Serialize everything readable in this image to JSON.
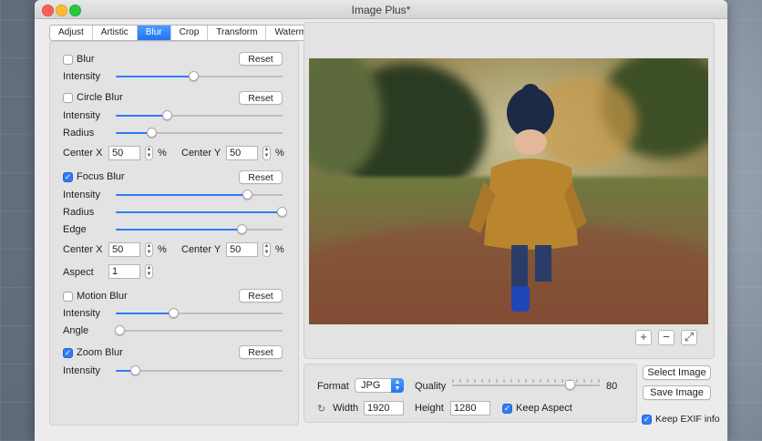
{
  "window": {
    "title": "Image Plus*"
  },
  "tabs": [
    {
      "label": "Adjust",
      "active": false
    },
    {
      "label": "Artistic",
      "active": false
    },
    {
      "label": "Blur",
      "active": true
    },
    {
      "label": "Crop",
      "active": false
    },
    {
      "label": "Transform",
      "active": false
    },
    {
      "label": "Watermark",
      "active": false
    }
  ],
  "blur": {
    "label": "Blur",
    "checked": false,
    "reset": "Reset",
    "intensity_label": "Intensity",
    "intensity": 0.47
  },
  "circle_blur": {
    "label": "Circle Blur",
    "checked": false,
    "reset": "Reset",
    "intensity_label": "Intensity",
    "intensity": 0.31,
    "radius_label": "Radius",
    "radius": 0.22,
    "center_x_label": "Center X",
    "center_x": "50",
    "center_y_label": "Center Y",
    "center_y": "50",
    "pct": "%"
  },
  "focus_blur": {
    "label": "Focus Blur",
    "checked": true,
    "reset": "Reset",
    "intensity_label": "Intensity",
    "intensity": 0.79,
    "radius_label": "Radius",
    "radius": 1.0,
    "edge_label": "Edge",
    "edge": 0.76,
    "center_x_label": "Center X",
    "center_x": "50",
    "center_y_label": "Center Y",
    "center_y": "50",
    "aspect_label": "Aspect",
    "aspect": "1",
    "pct": "%"
  },
  "motion_blur": {
    "label": "Motion Blur",
    "checked": false,
    "reset": "Reset",
    "intensity_label": "Intensity",
    "intensity": 0.35,
    "angle_label": "Angle",
    "angle": 0.03
  },
  "zoom_blur": {
    "label": "Zoom Blur",
    "checked": true,
    "reset": "Reset",
    "intensity_label": "Intensity",
    "intensity": 0.12
  },
  "preview": {
    "zoom_in_icon": "+",
    "zoom_out_icon": "−",
    "fit_icon": "⤢"
  },
  "output": {
    "format_label": "Format",
    "format": "JPG",
    "quality_label": "Quality",
    "quality": 80,
    "quality_text": "80",
    "width_label": "Width",
    "width": "1920",
    "height_label": "Height",
    "height": "1280",
    "keep_aspect_label": "Keep Aspect",
    "keep_aspect": true
  },
  "actions": {
    "select_image": "Select Image",
    "save_image": "Save Image",
    "keep_exif_label": "Keep EXIF info",
    "keep_exif": true
  },
  "colors": {
    "accent": "#2e7cf6"
  }
}
